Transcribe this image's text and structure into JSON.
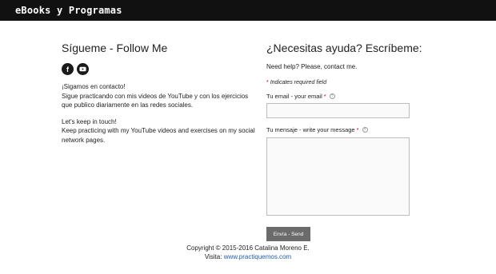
{
  "header": {
    "brand": "eBooks y Programas"
  },
  "left": {
    "title": "Sígueme - Follow Me",
    "socials": [
      {
        "icon": "facebook-icon",
        "glyph": "f"
      },
      {
        "icon": "youtube-icon",
        "glyph": ""
      }
    ],
    "para1": [
      "¡Sigamos en contacto!",
      "Sigue practicando con mis videos de YouTube y con los ejercicios que publico diariamente en las redes sociales."
    ],
    "para2": [
      "Let's keep in touch!",
      "Keep practicing with my YouTube videos and exercises on my social network pages."
    ]
  },
  "right": {
    "title": "¿Necesitas ayuda? Escríbeme:",
    "subtitle": "Need help? Please, contact me.",
    "required_note": "Indicates required field",
    "email_label": "Tu email - your email",
    "message_label": "Tu mensaje - write your message",
    "star": "*",
    "help": "?",
    "send_label": "Envía - Send"
  },
  "footer": {
    "copyright": "Copyright © 2015-2016 Catalina Moreno E.",
    "visit_label": "Visita:",
    "visit_link": "www.practiquemos.com"
  },
  "colors": {
    "topbar": "#111111",
    "required": "#d0021b",
    "button": "#6b6b6b",
    "link": "#1f5fa8"
  }
}
